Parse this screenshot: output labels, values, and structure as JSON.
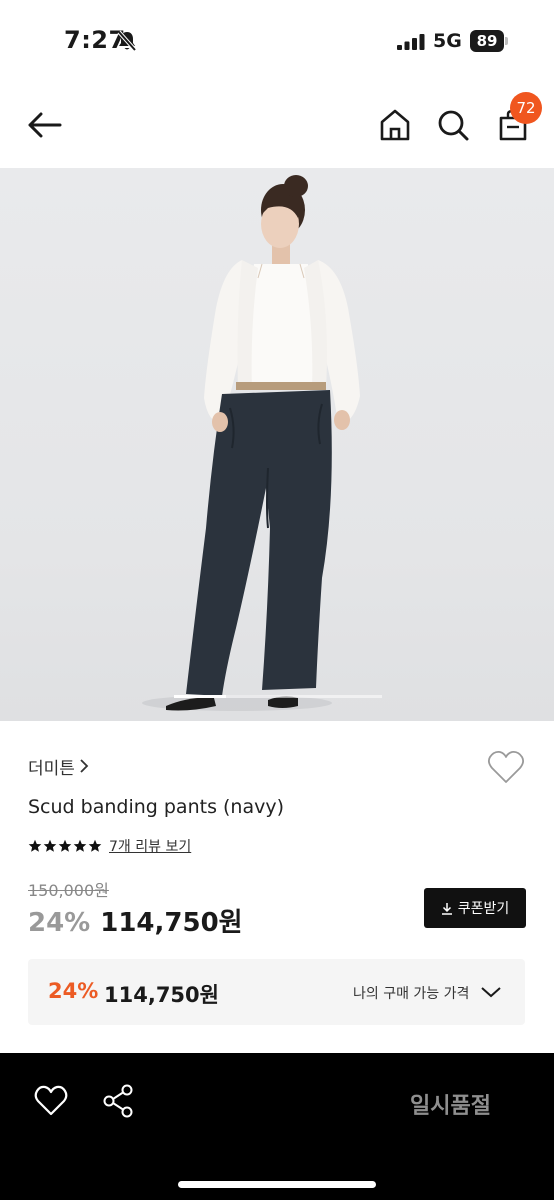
{
  "status_bar": {
    "time": "7:27",
    "network": "5G",
    "battery": "89"
  },
  "header": {
    "cart_count": "72"
  },
  "product_image": {
    "slide_progress": 0.25
  },
  "product": {
    "brand": "더미튼",
    "title": "Scud banding pants (navy)",
    "rating_stars": 5,
    "review_link": "7개 리뷰 보기",
    "original_price": "150,000원",
    "discount": "24%",
    "sale_price": "114,750원",
    "coupon_label": "쿠폰받기"
  },
  "my_price": {
    "discount": "24%",
    "price": "114,750원",
    "label": "나의 구매 가능 가격"
  },
  "bottom_bar": {
    "status_label": "일시품절"
  },
  "colors": {
    "accent": "#ec5b24",
    "badge": "#f0561f",
    "bottom_bar": "#000000"
  }
}
